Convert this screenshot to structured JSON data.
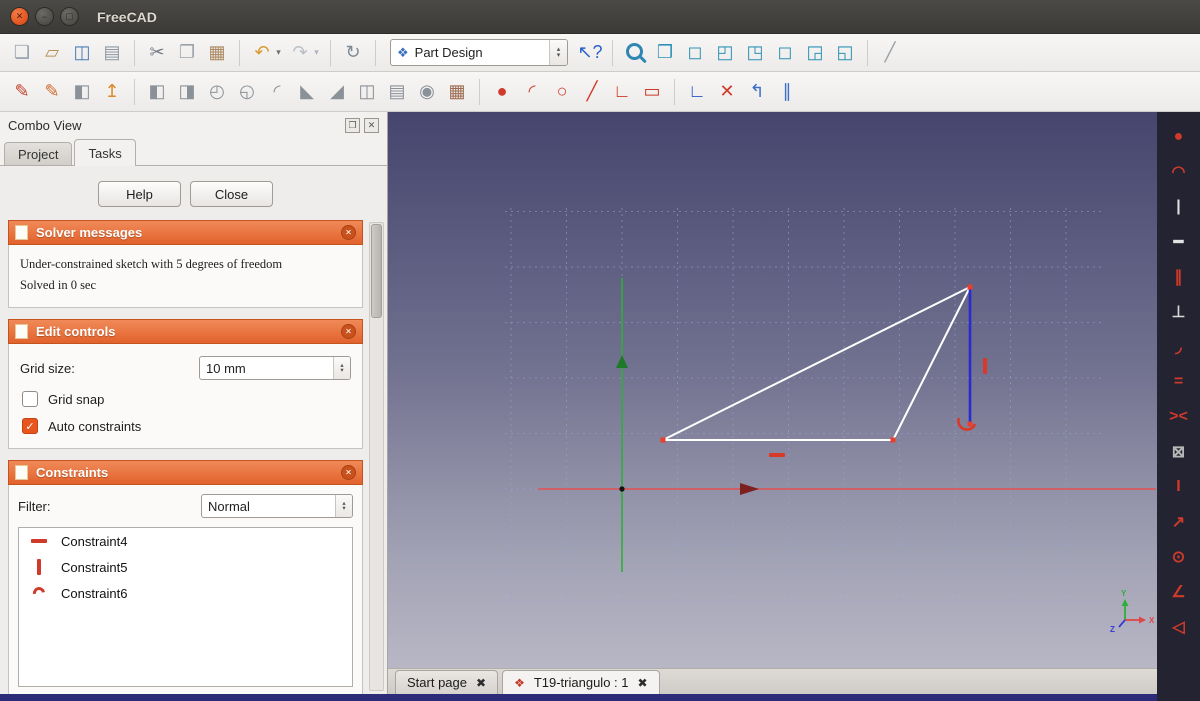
{
  "window": {
    "title": "FreeCAD"
  },
  "titlebar_buttons": [
    {
      "name": "close-window-button",
      "glyph": "✕"
    },
    {
      "name": "minimize-window-button",
      "glyph": "−"
    },
    {
      "name": "maximize-window-button",
      "glyph": "▢"
    }
  ],
  "ui": {
    "check_glyph": "✓",
    "spin_up": "▴",
    "spin_down": "▾"
  },
  "toolbar_main": {
    "workbench": {
      "selected": "Part Design",
      "icon_glyph": "❖"
    },
    "items": [
      {
        "name": "new-file-icon",
        "glyph": "❏",
        "color": "#93a0ac"
      },
      {
        "name": "open-file-icon",
        "glyph": "▱",
        "color": "#b89059"
      },
      {
        "name": "save-file-icon",
        "glyph": "◫",
        "color": "#4a7fb5"
      },
      {
        "name": "print-icon",
        "glyph": "▤",
        "color": "#8e98a2"
      },
      {
        "sep": true
      },
      {
        "name": "cut-icon",
        "glyph": "✂",
        "color": "#6f7680"
      },
      {
        "name": "copy-icon",
        "glyph": "❐",
        "color": "#9aa2ab"
      },
      {
        "name": "paste-icon",
        "glyph": "▦",
        "color": "#a9875f"
      },
      {
        "sep": true
      },
      {
        "name": "undo-icon",
        "glyph": "↶",
        "color": "#d89b2e"
      },
      {
        "name": "undo-dropdown-icon",
        "glyph": "▾",
        "color": "#707070",
        "small": true
      },
      {
        "name": "redo-icon",
        "glyph": "↷",
        "color": "#b9bfc6"
      },
      {
        "name": "redo-dropdown-icon",
        "glyph": "▾",
        "color": "#aeb4ba",
        "small": true
      },
      {
        "sep": true
      },
      {
        "name": "refresh-icon",
        "glyph": "↻",
        "color": "#7c8894"
      },
      {
        "sep": true
      },
      {
        "workbench": true
      },
      {
        "name": "whats-this-icon",
        "glyph": "↖?",
        "color": "#2a62c8"
      },
      {
        "sep": true
      },
      {
        "name": "zoom-fit-icon",
        "magnifier": true
      },
      {
        "name": "view-axonometric-icon",
        "glyph": "❒",
        "color": "#2e93b5"
      },
      {
        "name": "view-front-icon",
        "glyph": "◻",
        "color": "#2e93b5"
      },
      {
        "name": "view-top-icon",
        "glyph": "◰",
        "color": "#2e93b5"
      },
      {
        "name": "view-right-icon",
        "glyph": "◳",
        "color": "#2e93b5"
      },
      {
        "name": "view-rear-icon",
        "glyph": "◻",
        "color": "#2e93b5"
      },
      {
        "name": "view-bottom-icon",
        "glyph": "◲",
        "color": "#2e93b5"
      },
      {
        "name": "view-left-icon",
        "glyph": "◱",
        "color": "#2e93b5"
      },
      {
        "sep": true
      },
      {
        "name": "measure-icon",
        "glyph": "╱",
        "color": "#97a0a8"
      }
    ]
  },
  "toolbar_sketch": {
    "items": [
      {
        "name": "create-sketch-icon",
        "glyph": "✎",
        "color": "#c04028"
      },
      {
        "name": "edit-sketch-icon",
        "glyph": "✎",
        "color": "#d06a2a"
      },
      {
        "name": "view-sketch-icon",
        "glyph": "◧",
        "color": "#8b9198"
      },
      {
        "name": "map-sketch-icon",
        "glyph": "↥",
        "color": "#d98a24"
      },
      {
        "sep": true
      },
      {
        "name": "pad-icon",
        "glyph": "◧",
        "color": "#8b9198"
      },
      {
        "name": "pocket-icon",
        "glyph": "◨",
        "color": "#8b9198"
      },
      {
        "name": "revolution-icon",
        "glyph": "◴",
        "color": "#8b9198"
      },
      {
        "name": "groove-icon",
        "glyph": "◵",
        "color": "#8b9198"
      },
      {
        "name": "fillet-icon",
        "glyph": "◜",
        "color": "#8b9198"
      },
      {
        "name": "chamfer-icon",
        "glyph": "◣",
        "color": "#8b9198"
      },
      {
        "name": "draft-icon",
        "glyph": "◢",
        "color": "#8b9198"
      },
      {
        "name": "mirrored-icon",
        "glyph": "◫",
        "color": "#8b9198"
      },
      {
        "name": "linear-pattern-icon",
        "glyph": "▤",
        "color": "#8b9198"
      },
      {
        "name": "polar-pattern-icon",
        "glyph": "◉",
        "color": "#8b9198"
      },
      {
        "name": "multitransform-icon",
        "glyph": "▦",
        "color": "#9b6a50"
      },
      {
        "sep": true
      },
      {
        "name": "point-icon",
        "glyph": "●",
        "color": "#cf3a2a"
      },
      {
        "name": "arc-icon",
        "glyph": "◜",
        "color": "#cf3a2a"
      },
      {
        "name": "circle-icon",
        "glyph": "○",
        "color": "#cf3a2a"
      },
      {
        "name": "line-icon",
        "glyph": "╱",
        "color": "#cf3a2a"
      },
      {
        "name": "polyline-icon",
        "glyph": "∟",
        "color": "#cf3a2a"
      },
      {
        "name": "rectangle-icon",
        "glyph": "▭",
        "color": "#cf3a2a"
      },
      {
        "sep": true
      },
      {
        "name": "origin-axes-icon",
        "glyph": "∟",
        "color": "#2a55c8"
      },
      {
        "name": "trim-icon",
        "glyph": "✕",
        "color": "#cf3a2a"
      },
      {
        "name": "external-geometry-icon",
        "glyph": "↰",
        "color": "#3a6ec8"
      },
      {
        "name": "construction-mode-icon",
        "glyph": "∥",
        "color": "#3a6ec8"
      }
    ]
  },
  "combo_view": {
    "title": "Combo View",
    "dock_icons": [
      {
        "name": "float-panel-icon",
        "glyph": "❐"
      },
      {
        "name": "close-panel-icon",
        "glyph": "✕"
      }
    ],
    "tabs": [
      {
        "label": "Project",
        "active": false
      },
      {
        "label": "Tasks",
        "active": true
      }
    ],
    "buttons": {
      "help": "Help",
      "close": "Close"
    },
    "collapse_glyph": "✕",
    "solver": {
      "title": "Solver messages",
      "messages": [
        "Under-constrained sketch with 5 degrees of freedom",
        "Solved in 0 sec"
      ]
    },
    "edit_controls": {
      "title": "Edit controls",
      "grid_size_label": "Grid size:",
      "grid_size_value": "10 mm",
      "grid_snap_label": "Grid snap",
      "grid_snap_checked": false,
      "auto_constraints_label": "Auto constraints",
      "auto_constraints_checked": true
    },
    "constraints": {
      "title": "Constraints",
      "filter_label": "Filter:",
      "filter_value": "Normal",
      "items": [
        {
          "label": "Constraint4",
          "icon": "horizontal-constraint-icon"
        },
        {
          "label": "Constraint5",
          "icon": "vertical-constraint-icon"
        },
        {
          "label": "Constraint6",
          "icon": "arc-constraint-icon"
        }
      ]
    }
  },
  "viewport": {
    "axis_labels": {
      "x": "X",
      "y": "Y",
      "z": "Z"
    },
    "colors": {
      "background_top": "#45456e",
      "background_bottom": "#b7b7c5",
      "x_axis": "#e35050",
      "y_axis": "#2fae3a",
      "sketch_edge": "#ffffff",
      "selected_edge": "#2a2ad2",
      "constraint_marker": "#d93a28",
      "vertex": "#e8402c"
    }
  },
  "document_tabs": [
    {
      "name": "tab-start-page",
      "label": "Start page",
      "active": false,
      "close_glyph": "✖"
    },
    {
      "name": "tab-document",
      "label": "T19-triangulo : 1",
      "active": true,
      "icon_glyph": "❖",
      "close_glyph": "✖"
    }
  ],
  "right_toolbar": {
    "items": [
      {
        "name": "constraint-coincident-icon",
        "glyph": "●",
        "color": "#cf3a2a"
      },
      {
        "name": "constraint-point-on-object-icon",
        "glyph": "◠",
        "color": "#cf3a2a"
      },
      {
        "name": "constraint-vertical-icon",
        "glyph": "|",
        "color": "#e3e3e3"
      },
      {
        "name": "constraint-horizontal-icon",
        "glyph": "━",
        "color": "#e3e3e3"
      },
      {
        "name": "constraint-parallel-icon",
        "glyph": "∥",
        "color": "#cf3a2a"
      },
      {
        "name": "constraint-perpendicular-icon",
        "glyph": "⊥",
        "color": "#d8d8d8"
      },
      {
        "name": "constraint-tangent-icon",
        "glyph": "◞",
        "color": "#cf3a2a"
      },
      {
        "name": "constraint-equal-icon",
        "glyph": "=",
        "color": "#cf3a2a"
      },
      {
        "name": "constraint-symmetric-icon",
        "glyph": "><",
        "color": "#cf3a2a"
      },
      {
        "name": "constraint-lock-icon",
        "glyph": "⊠",
        "color": "#b8b8b8"
      },
      {
        "name": "constraint-distance-y-icon",
        "glyph": "I",
        "color": "#cf3a2a"
      },
      {
        "name": "constraint-distance-icon",
        "glyph": "↗",
        "color": "#cf3a2a"
      },
      {
        "name": "constraint-radius-icon",
        "glyph": "⊙",
        "color": "#cf3a2a"
      },
      {
        "name": "constraint-angle-icon",
        "glyph": "∠",
        "color": "#cf3a2a"
      },
      {
        "name": "constraint-snell-icon",
        "glyph": "◁",
        "color": "#cf3a2a"
      }
    ]
  }
}
